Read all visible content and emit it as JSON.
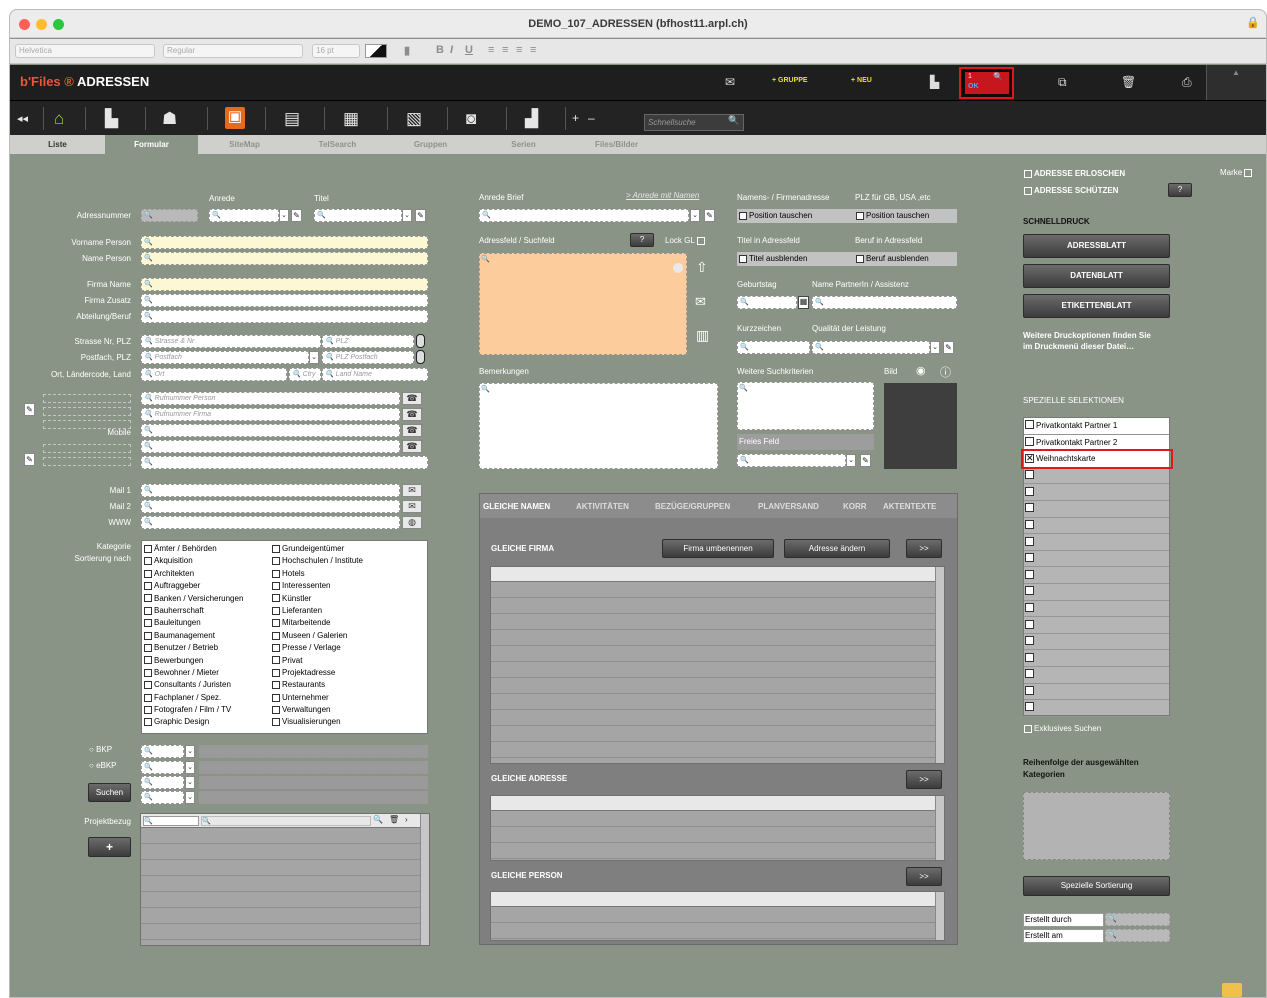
{
  "window": {
    "title": "DEMO_107_ADRESSEN (bfhost11.arpl.ch)"
  },
  "format_bar": {
    "font": "Helvetica",
    "style": "Regular",
    "size": "16 pt",
    "bold": "B",
    "italic": "I",
    "underline": "U"
  },
  "app": {
    "brand": "b'Files ®",
    "title": "ADRESSEN",
    "add_group": "+ GRUPPE",
    "add_new": "+ NEU",
    "record_number": "1",
    "ok_label": "OK",
    "plus": "+",
    "minus": "–"
  },
  "quick_search": {
    "placeholder": "Schnellsuche"
  },
  "tabs": [
    "Liste",
    "Formular",
    "SiteMap",
    "TelSearch",
    "Gruppen",
    "Serien",
    "Files/Bilder"
  ],
  "form": {
    "anrede": "Anrede",
    "titel": "Titel",
    "adressnummer": "Adressnummer",
    "vorname": "Vorname Person",
    "name": "Name Person",
    "firma_name": "Firma Name",
    "firma_zusatz": "Firma Zusatz",
    "abteilung": "Abteilung/Beruf",
    "strasse": "Strasse Nr, PLZ",
    "postfach": "Postfach, PLZ",
    "ort": "Ort, Ländercode, Land",
    "mobile": "Mobile",
    "mail1": "Mail 1",
    "mail2": "Mail 2",
    "www": "WWW",
    "kategorie": "Kategorie",
    "sortierung": "Sortierung nach",
    "projektbezug": "Projektbezug",
    "ph_strasse": "Strasse & Nr",
    "ph_plz": "PLZ",
    "ph_postfach": "Postfach",
    "ph_plz_postfach": "PLZ Postfach",
    "ph_ort": "Ort",
    "ph_ctry": "Ctry",
    "ph_land": "Land Name",
    "ph_rufnummer_person": "Rufnummer Person",
    "ph_rufnummer_firma": "Rufnummer Firma",
    "bkp": "BKP",
    "ebkp": "eBKP",
    "suchen": "Suchen",
    "plus": "+"
  },
  "categories_left": [
    "Ämter / Behörden",
    "Akquisition",
    "Architekten",
    "Auftraggeber",
    "Banken / Versicherungen",
    "Bauherrschaft",
    "Bauleitungen",
    "Baumanagement",
    "Benutzer / Betrieb",
    "Bewerbungen",
    "Bewohner / Mieter",
    "Consultants / Juristen",
    "Fachplaner / Spez.",
    "Fotografen / Film / TV",
    "Graphic Design"
  ],
  "categories_right": [
    "Grundeigentümer",
    "Hochschulen / Institute",
    "Hotels",
    "Interessenten",
    "Künstler",
    "Lieferanten",
    "Mitarbeitende",
    "Museen / Galerien",
    "Presse / Verlage",
    "Privat",
    "Projektadresse",
    "Restaurants",
    "Unternehmer",
    "Verwaltungen",
    "Visualisierungen"
  ],
  "middle": {
    "anrede_brief": "Anrede Brief",
    "anrede_mit_namen": "> Anrede mit Namen",
    "adressfeld": "Adressfeld / Suchfeld",
    "lock_gl": "Lock GL",
    "bemerkungen": "Bemerkungen",
    "namens_firmenadresse": "Namens- / Firmenadresse",
    "plz_fur": "PLZ für GB, USA ,etc",
    "position_tauschen": "Position tauschen",
    "titel_in_adressfeld": "Titel in Adressfeld",
    "beruf_in_adressfeld": "Beruf in Adressfeld",
    "titel_ausblenden": "Titel ausblenden",
    "beruf_ausblenden": "Beruf ausblenden",
    "geburtstag": "Geburtstag",
    "partnerin": "Name PartnerIn / Assistenz",
    "kurzzeichen": "Kurzzeichen",
    "qualitaet": "Qualität der Leistung",
    "suchkriterien": "Weitere Suchkriterien",
    "bild": "Bild",
    "freies_feld": "Freies Feld",
    "info_button": "?"
  },
  "bottom_tabs": [
    "GLEICHE NAMEN",
    "AKTIVITÄTEN",
    "BEZÜGE/GRUPPEN",
    "PLANVERSAND",
    "KORR",
    "AKTENTEXTE"
  ],
  "gleiche": {
    "firma": "GLEICHE FIRMA",
    "adresse": "GLEICHE ADRESSE",
    "person": "GLEICHE PERSON",
    "firma_umbenennen": "Firma umbenennen",
    "adresse_aendern": "Adresse ändern",
    "more": ">>"
  },
  "right": {
    "marke": "Marke",
    "adresse_erloschen": "ADRESSE ERLOSCHEN",
    "adresse_schuetzen": "ADRESSE SCHÜTZEN",
    "info": "?",
    "schnelldruck": "SCHNELLDRUCK",
    "adressblatt": "ADRESSBLATT",
    "datenblatt": "DATENBLATT",
    "etikettenblatt": "ETIKETTENBLATT",
    "druck_info": "Weitere Druckoptionen finden Sie im Druckmenü dieser Datei…",
    "spezielle_selektionen": "SPEZIELLE SELEKTIONEN",
    "selections": [
      "Privatkontakt Partner 1",
      "Privatkontakt Partner 2",
      "Weihnachtskarte"
    ],
    "exklusives_suchen": "Exklusives Suchen",
    "reihenfolge": "Reihenfolge der ausgewählten Kategorien",
    "spezielle_sortierung": "Spezielle Sortierung",
    "erstellt_durch": "Erstellt durch",
    "erstellt_am": "Erstellt am"
  },
  "colors": {
    "accent_red": "#e01818",
    "brand_orange": "#e8563c",
    "window_bg": "#8a9486",
    "address_field": "#fccc9c"
  }
}
